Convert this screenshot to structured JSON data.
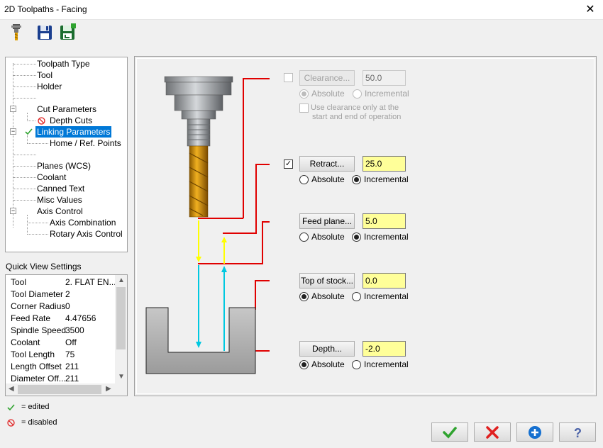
{
  "window": {
    "title": "2D Toolpaths - Facing",
    "close_glyph": "✕"
  },
  "tree": {
    "items": [
      {
        "label": "Toolpath Type"
      },
      {
        "label": "Tool"
      },
      {
        "label": "Holder"
      },
      {
        "label": ""
      },
      {
        "label": "Cut Parameters"
      },
      {
        "label": "Depth Cuts"
      },
      {
        "label": "Linking Parameters"
      },
      {
        "label": "Home / Ref. Points"
      },
      {
        "label": ""
      },
      {
        "label": "Planes (WCS)"
      },
      {
        "label": "Coolant"
      },
      {
        "label": "Canned Text"
      },
      {
        "label": "Misc Values"
      },
      {
        "label": "Axis Control"
      },
      {
        "label": "Axis Combination"
      },
      {
        "label": "Rotary Axis Control"
      }
    ]
  },
  "quick_view": {
    "label": "Quick View Settings",
    "rows": [
      {
        "key": "Tool",
        "value": "2. FLAT EN..."
      },
      {
        "key": "Tool Diameter",
        "value": "2"
      },
      {
        "key": "Corner Radius",
        "value": "0"
      },
      {
        "key": "Feed Rate",
        "value": "4.47656"
      },
      {
        "key": "Spindle Speed",
        "value": "3500"
      },
      {
        "key": "Coolant",
        "value": "Off"
      },
      {
        "key": "Tool Length",
        "value": "75"
      },
      {
        "key": "Length Offset",
        "value": "211"
      },
      {
        "key": "Diameter Off...",
        "value": "211"
      }
    ]
  },
  "legend": {
    "edited": "= edited",
    "disabled": "= disabled"
  },
  "linking": {
    "clearance": {
      "button": "Clearance...",
      "value": "50.0",
      "enabled": false
    },
    "clearance_absolute": "Absolute",
    "clearance_incremental": "Incremental",
    "clearance_note_1": "Use clearance only at the",
    "clearance_note_2": "start and end of operation",
    "retract": {
      "button": "Retract...",
      "value": "25.0",
      "enabled": true
    },
    "retract_absolute": "Absolute",
    "retract_incremental": "Incremental",
    "feed_plane": {
      "button": "Feed plane...",
      "value": "5.0"
    },
    "feed_absolute": "Absolute",
    "feed_incremental": "Incremental",
    "top_of_stock": {
      "button": "Top of stock...",
      "value": "0.0"
    },
    "top_absolute": "Absolute",
    "top_incremental": "Incremental",
    "depth": {
      "button": "Depth...",
      "value": "-2.0"
    },
    "depth_absolute": "Absolute",
    "depth_incremental": "Incremental"
  },
  "colors": {
    "accent": "#0078d7",
    "input_highlight": "#ffff99",
    "link_line": "#e00000",
    "feed_move": "#ffff00",
    "rapid_move": "#00c8e0",
    "ok_green": "#2fa32f",
    "cancel_red": "#e02020",
    "add_blue": "#1570d0"
  },
  "icons": [
    "tool-icon",
    "save-icon",
    "save-as-icon",
    "edited-check-icon",
    "disabled-icon",
    "ok-check-icon",
    "cancel-x-icon",
    "add-plus-icon",
    "help-icon"
  ]
}
